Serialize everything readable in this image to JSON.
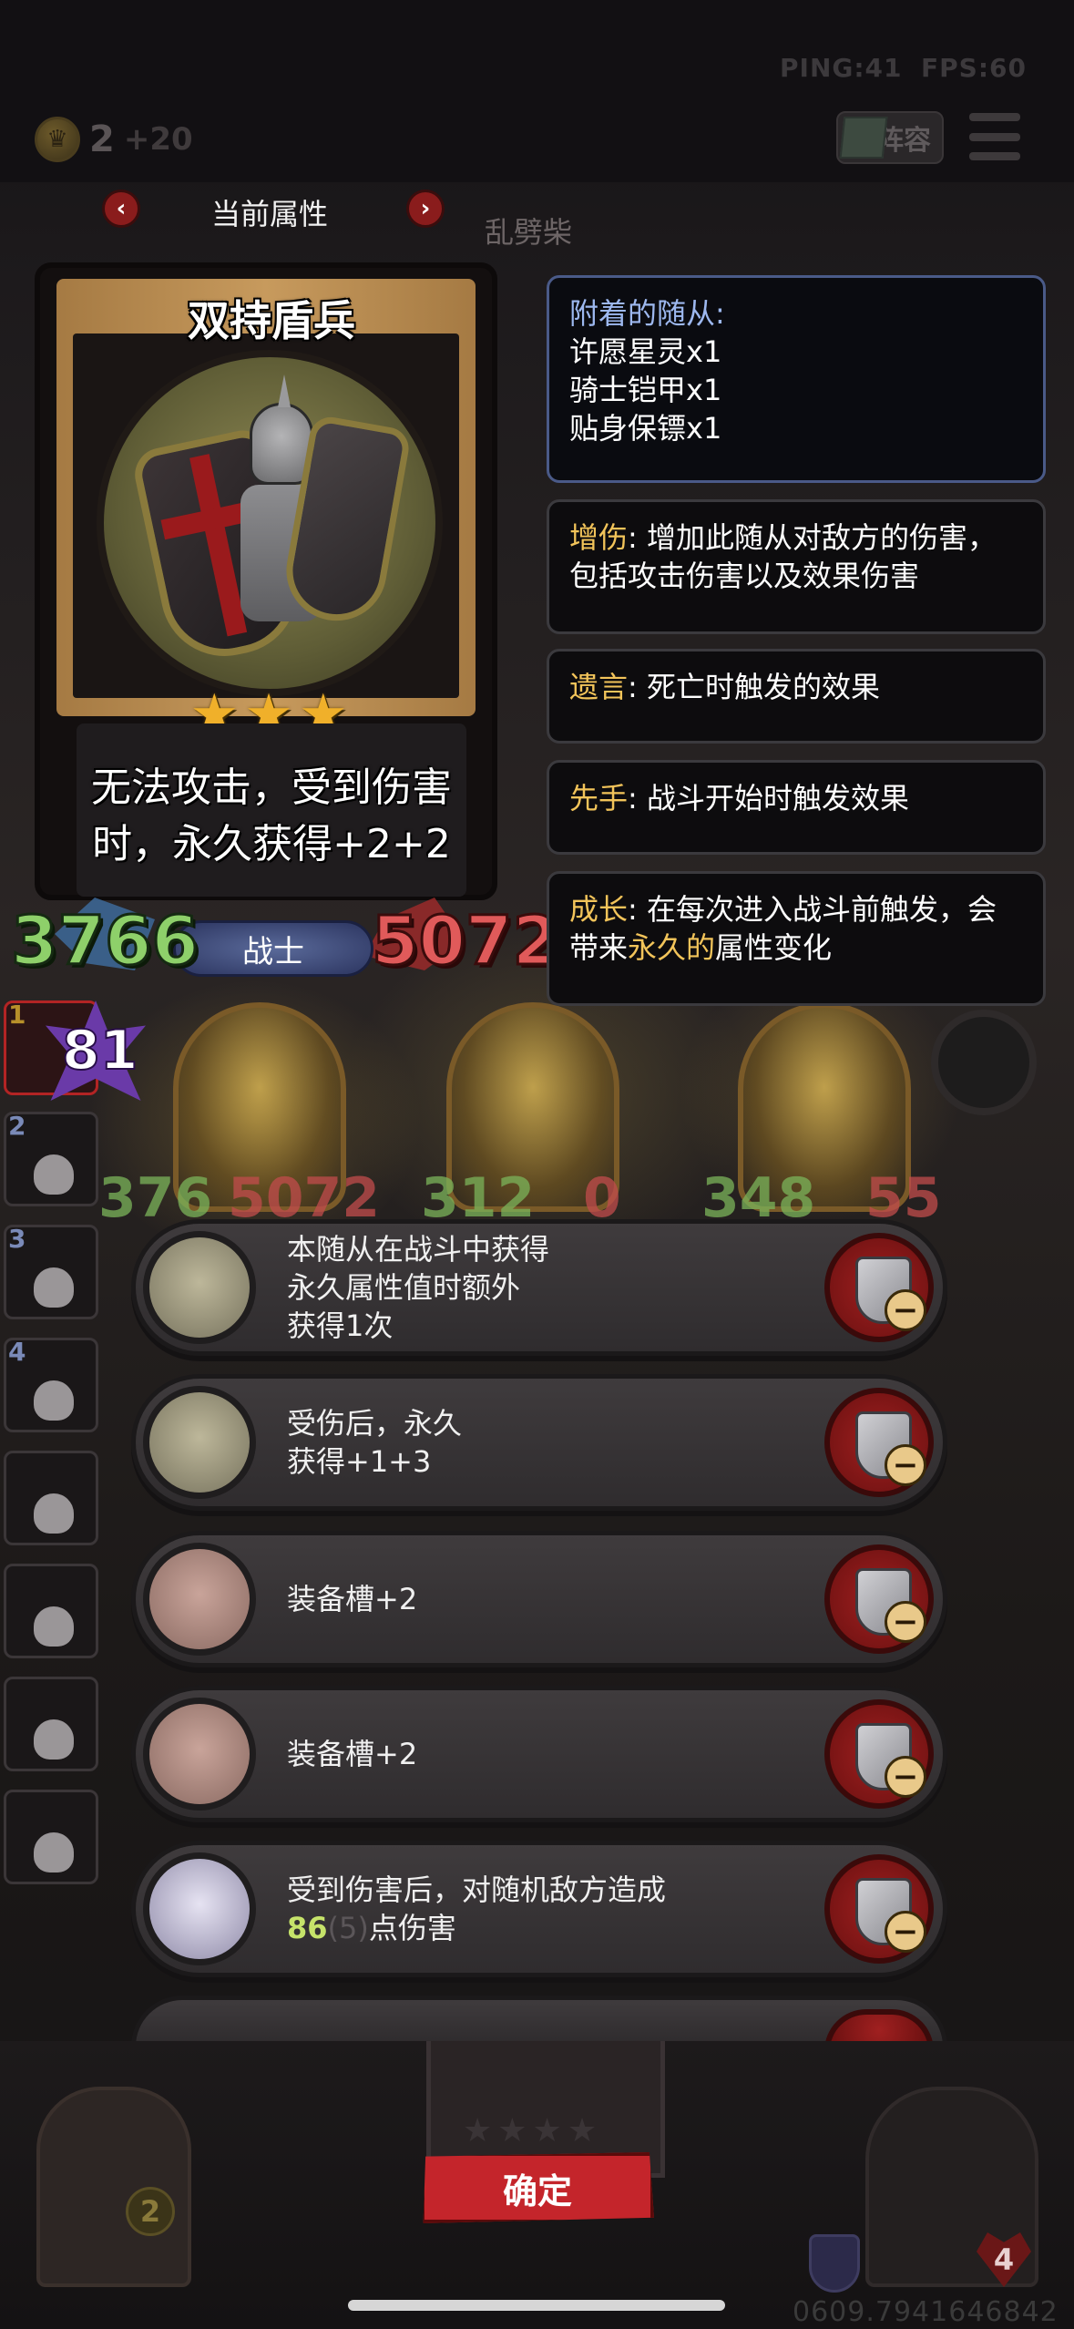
{
  "status": {
    "ping": "PING:41",
    "fps": "FPS:60"
  },
  "currency": {
    "amount": "2",
    "income": "+20"
  },
  "header": {
    "lineup_label": "阵容",
    "props_title": "当前属性",
    "prev": "‹",
    "next": "›",
    "board_name": "乱劈柴"
  },
  "card": {
    "name": "双持盾兵",
    "stars": "★★★",
    "description_line1": "无法攻击，受到伤害",
    "description_line2": "时，永久获得+2+2",
    "attack": "3766",
    "health": "5072",
    "class": "战士"
  },
  "info": {
    "attached_title": "附着的随从:",
    "attached": [
      "许愿星灵x1",
      "骑士铠甲x1",
      "贴身保镖x1"
    ],
    "keywords": [
      {
        "term": "增伤",
        "sep": ": ",
        "text": "增加此随从对敌方的伤害，",
        "text2": "包括攻击伤害以及效果伤害"
      },
      {
        "term": "遗言",
        "sep": ": ",
        "text": "死亡时触发的效果"
      },
      {
        "term": "先手",
        "sep": ": ",
        "text": "战斗开始时触发效果"
      },
      {
        "term": "成长",
        "sep": ": ",
        "text": "在每次进入战斗前触发，会",
        "text2_a": "带来",
        "text2_hl": "永久的",
        "text2_b": "属性变化"
      }
    ]
  },
  "tier": {
    "value": "81"
  },
  "sidebar": {
    "slots": [
      "1",
      "2",
      "3",
      "4",
      "",
      "",
      "",
      ""
    ]
  },
  "board": {
    "numbers": [
      "376",
      "5072",
      "312",
      "0",
      "348",
      "55"
    ]
  },
  "equipment": [
    {
      "lines": [
        "本随从在战斗中获得",
        "永久属性值时额外",
        "获得1次"
      ],
      "icon": "crown-ring-icon"
    },
    {
      "lines": [
        "受伤后，永久",
        "获得+1+3"
      ],
      "icon": "candelabra-icon"
    },
    {
      "lines": [
        "装备槽+2"
      ],
      "icon": "pig-sack-icon"
    },
    {
      "lines": [
        "装备槽+2"
      ],
      "icon": "pig-sack-icon"
    },
    {
      "line1": "受到伤害后，对随机敌方造成",
      "dmg": "86",
      "dmg_base": "(5)",
      "dmg_suffix": "点伤害",
      "icon": "crystal-icon"
    }
  ],
  "bottom": {
    "confirm_label": "确定",
    "chest_count": "2",
    "hero_hp": "4",
    "stars": "★★★★",
    "session_id": "0609.7941646842"
  },
  "colors": {
    "confirm": "#c4252b",
    "attack": "#8ed06a",
    "health": "#e05a5a",
    "keyword": "#f2c45a",
    "attached": "#9db8ef"
  }
}
